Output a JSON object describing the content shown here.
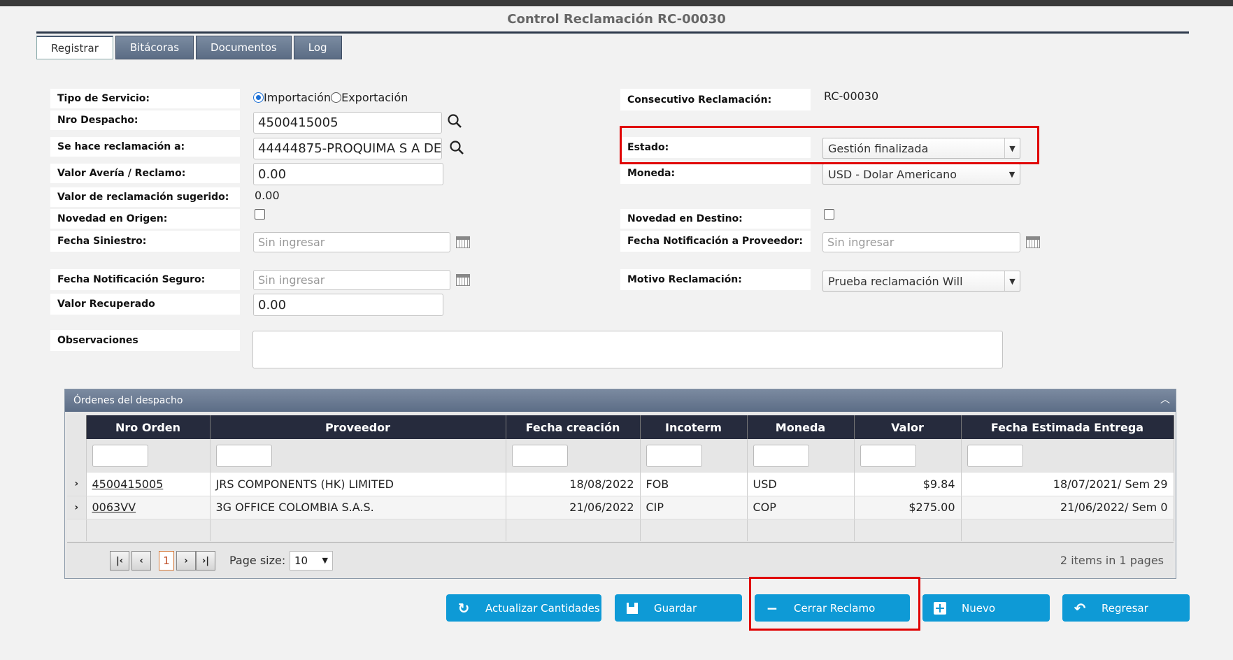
{
  "page": {
    "title": "Control Reclamación RC-00030"
  },
  "tabs": [
    {
      "label": "Registrar"
    },
    {
      "label": "Bitácoras"
    },
    {
      "label": "Documentos"
    },
    {
      "label": "Log"
    }
  ],
  "form": {
    "tipo_servicio": {
      "label": "Tipo de Servicio:",
      "option1": "Importación",
      "option2": "Exportación",
      "selected": "Importación"
    },
    "nro_despacho": {
      "label": "Nro Despacho:",
      "value": "4500415005"
    },
    "reclamacion_a": {
      "label": "Se hace reclamación a:",
      "value": "44444875-PROQUIMA S A DE"
    },
    "valor_averia": {
      "label": "Valor Avería / Reclamo:",
      "value": "0.00"
    },
    "valor_sugerido": {
      "label": "Valor de reclamación sugerido:",
      "value": "0.00"
    },
    "novedad_origen": {
      "label": "Novedad en Origen:"
    },
    "fecha_siniestro": {
      "label": "Fecha Siniestro:",
      "placeholder": "Sin ingresar"
    },
    "fecha_notif_seguro": {
      "label": "Fecha Notificación Seguro:",
      "placeholder": "Sin ingresar"
    },
    "valor_recuperado": {
      "label": "Valor Recuperado",
      "value": "0.00"
    },
    "observaciones": {
      "label": "Observaciones",
      "value": ""
    },
    "consecutivo": {
      "label": "Consecutivo Reclamación:",
      "value": "RC-00030"
    },
    "estado": {
      "label": "Estado:",
      "value": "Gestión finalizada"
    },
    "moneda": {
      "label": "Moneda:",
      "value": "USD - Dolar Americano"
    },
    "novedad_destino": {
      "label": "Novedad en Destino:"
    },
    "fecha_notif_proveedor": {
      "label": "Fecha Notificación a Proveedor:",
      "placeholder": "Sin ingresar"
    },
    "motivo": {
      "label": "Motivo Reclamación:",
      "value": "Prueba reclamación Will"
    }
  },
  "grid": {
    "title": "Órdenes del despacho",
    "columns": [
      "Nro Orden",
      "Proveedor",
      "Fecha creación",
      "Incoterm",
      "Moneda",
      "Valor",
      "Fecha Estimada Entrega"
    ],
    "rows": [
      {
        "orden": "4500415005",
        "proveedor": "JRS COMPONENTS (HK) LIMITED",
        "fecha": "18/08/2022",
        "incoterm": "FOB",
        "moneda": "USD",
        "valor": "$9.84",
        "entrega": "18/07/2021/ Sem 29"
      },
      {
        "orden": "0063VV",
        "proveedor": "3G OFFICE COLOMBIA S.A.S.",
        "fecha": "21/06/2022",
        "incoterm": "CIP",
        "moneda": "COP",
        "valor": "$275.00",
        "entrega": "21/06/2022/ Sem 0"
      }
    ],
    "pager": {
      "current_page": "1",
      "page_size_label": "Page size:",
      "page_size": "10",
      "info": "2 items in 1 pages"
    }
  },
  "buttons": {
    "actualizar": "Actualizar Cantidades",
    "guardar": "Guardar",
    "cerrar": "Cerrar Reclamo",
    "nuevo": "Nuevo",
    "regresar": "Regresar"
  },
  "colors": {
    "accent": "#0e9ad6",
    "header": "#262b3d",
    "highlight": "#e00000"
  }
}
